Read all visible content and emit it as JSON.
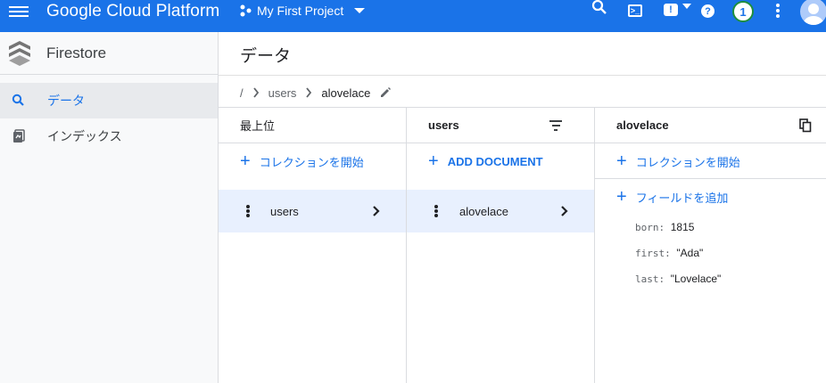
{
  "topbar": {
    "brand": "Google Cloud Platform",
    "project": "My First Project",
    "notifications_count": "1",
    "shell_label": ">_",
    "feedback_label": "!",
    "help_label": "?"
  },
  "sidebar": {
    "title": "Firestore",
    "items": [
      {
        "label": "データ",
        "icon": "search-icon",
        "active": true
      },
      {
        "label": "インデックス",
        "icon": "index-icon",
        "active": false
      }
    ]
  },
  "main": {
    "page_title": "データ",
    "breadcrumb": {
      "root": "/",
      "collection": "users",
      "document": "alovelace"
    },
    "columns": [
      {
        "header": "最上位",
        "action_label": "コレクションを開始",
        "selected_item": "users"
      },
      {
        "header": "users",
        "action_label": "ADD DOCUMENT",
        "selected_item": "alovelace"
      },
      {
        "header": "alovelace",
        "action_label": "コレクションを開始",
        "field_action_label": "フィールドを追加",
        "fields": [
          {
            "key": "born:",
            "value": "1815"
          },
          {
            "key": "first:",
            "value": "\"Ada\""
          },
          {
            "key": "last:",
            "value": "\"Lovelace\""
          }
        ]
      }
    ]
  },
  "colors": {
    "accent": "#1a73e8",
    "selected_row": "#e8f0fe",
    "sidebar_bg": "#f8f9fa"
  }
}
